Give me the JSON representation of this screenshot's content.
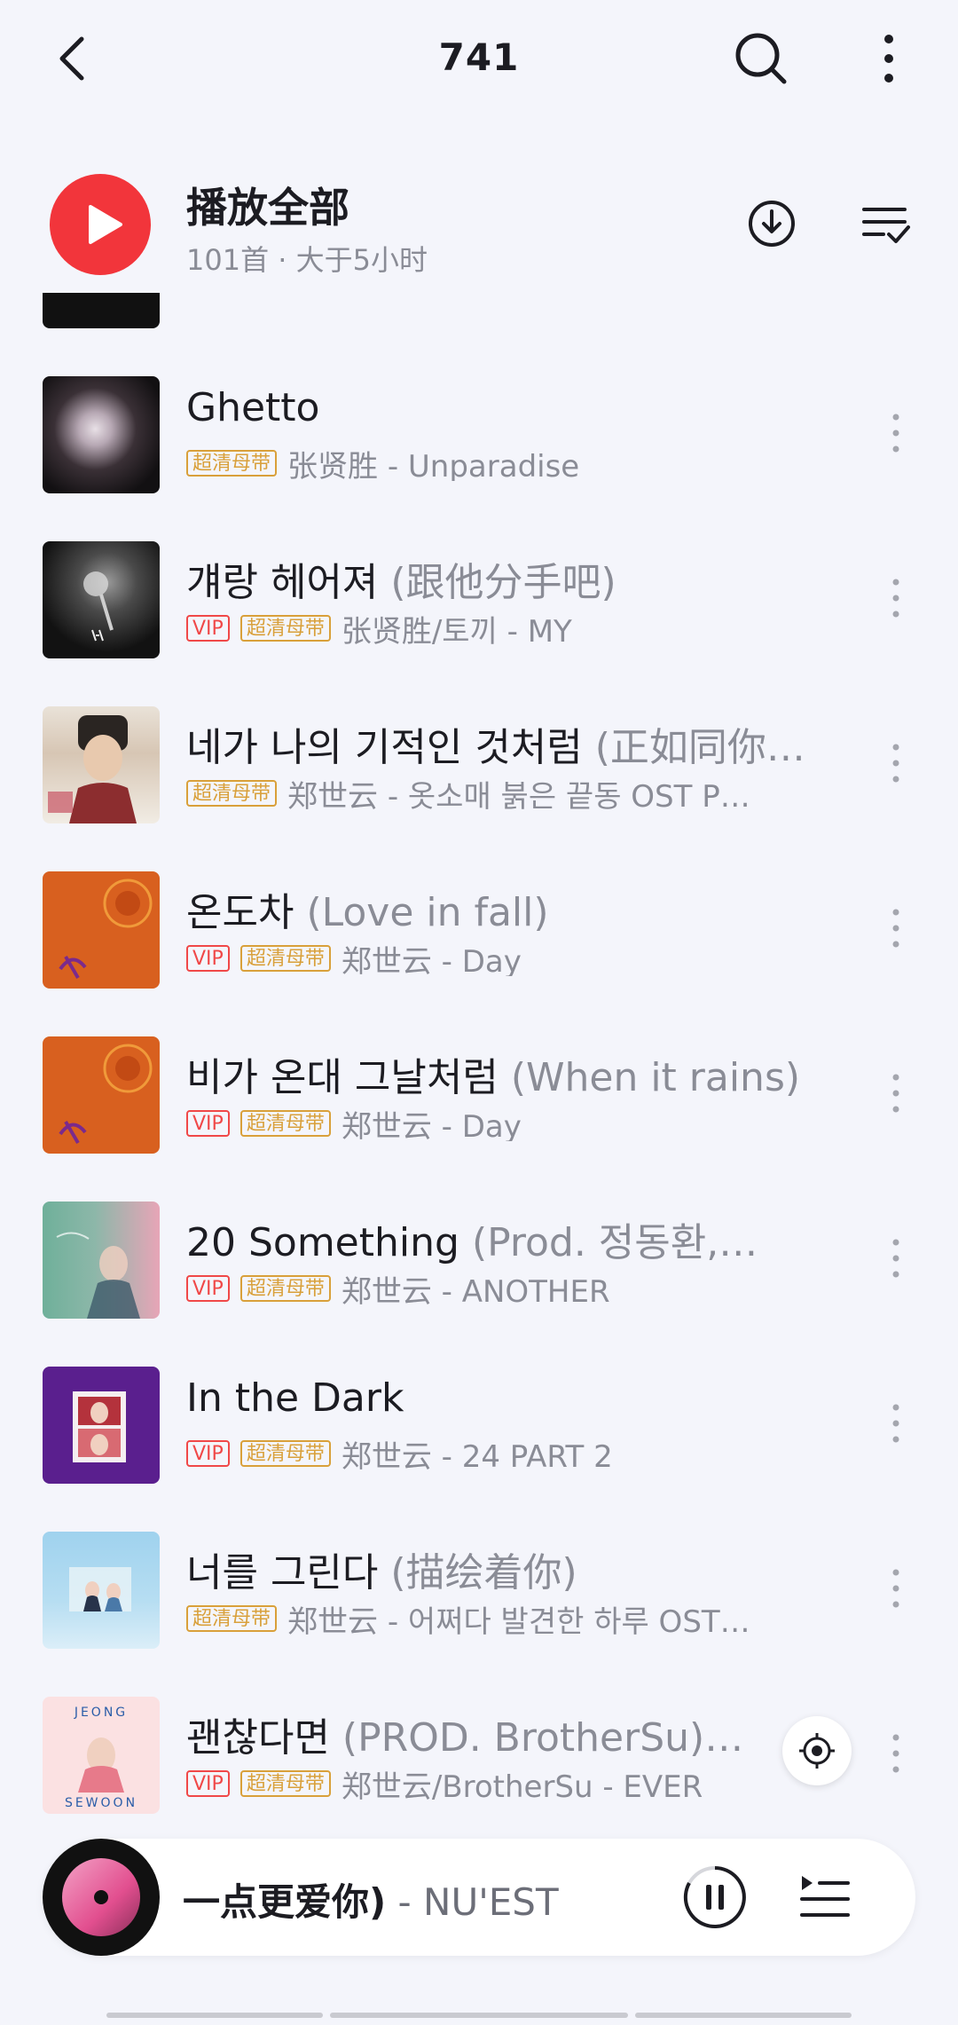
{
  "header": {
    "title": "741"
  },
  "play_all": {
    "title": "播放全部",
    "subtitle": "101首 · 大于5小时"
  },
  "badges": {
    "vip": "VIP",
    "sq": "超清母带"
  },
  "songs": [
    {
      "title": "Ghetto",
      "subtitle": "",
      "vip": false,
      "artist_album": "张贤胜 - Unparadise"
    },
    {
      "title": "걔랑 헤어져",
      "subtitle": "(跟他分手吧)",
      "vip": true,
      "artist_album": "张贤胜/토끼 - MY"
    },
    {
      "title": "네가 나의 기적인 것처럼",
      "subtitle": "(正如同你…",
      "vip": false,
      "artist_album": "郑世云 - 옷소매 붉은 끝동 OST P…"
    },
    {
      "title": "온도차",
      "subtitle": "(Love in fall)",
      "vip": true,
      "artist_album": "郑世云 - Day"
    },
    {
      "title": "비가 온대 그날처럼",
      "subtitle": "(When it rains)",
      "vip": true,
      "artist_album": "郑世云 - Day"
    },
    {
      "title": "20 Something",
      "subtitle": "(Prod. 정동환,…",
      "vip": true,
      "artist_album": "郑世云 - ANOTHER"
    },
    {
      "title": "In the Dark",
      "subtitle": "",
      "vip": true,
      "artist_album": "郑世云 - 24 PART 2"
    },
    {
      "title": "너를 그린다",
      "subtitle": "(描绘着你)",
      "vip": false,
      "artist_album": "郑世云 - 어쩌다 발견한 하루 OST…"
    },
    {
      "title": "괜찮다면",
      "subtitle": "(PROD. BrotherSu)…",
      "vip": true,
      "artist_album": "郑世云/BrotherSu - EVER"
    }
  ],
  "cover_text": {
    "jeong": "JEONG",
    "sewoon": "SEWOON"
  },
  "player": {
    "now_title": "一点更爱你)",
    "now_artist": " - NU'EST"
  },
  "colors": {
    "accent_red": "#f2353b",
    "vip_red": "#f04848",
    "sq_gold": "#d9a03a"
  }
}
